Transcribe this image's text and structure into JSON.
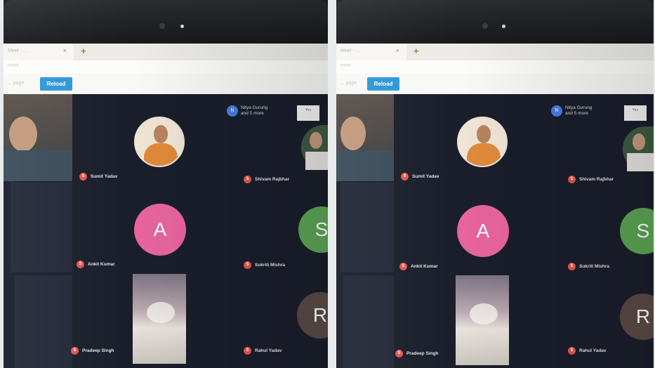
{
  "browser": {
    "tab_title": "Meet - ...",
    "tab_close": "×",
    "new_tab": "+",
    "address_text": "meet",
    "toolbar_text": "... page",
    "reload_label": "Reload"
  },
  "meeting": {
    "overflow": {
      "initial": "N",
      "line1": "Nitya Gurung",
      "line2": "and 5 more"
    },
    "self_preview_label": "You",
    "participants": [
      {
        "name": "Sumit Yadav",
        "type": "video"
      },
      {
        "name": "Shivam Rajbhar",
        "type": "video"
      },
      {
        "name": "Ankit Kumar",
        "type": "avatar",
        "initial": "A",
        "color": "#e7649d"
      },
      {
        "name": "Sukriti Mishra",
        "type": "avatar",
        "initial": "S",
        "color": "#5ba553"
      },
      {
        "name": "Pradeep Singh",
        "type": "video"
      },
      {
        "name": "Rahul Yadav",
        "type": "avatar",
        "initial": "R",
        "color": "#5a4a46"
      }
    ],
    "mic_icon": "mic-off-icon",
    "accent": "#2d97d8"
  }
}
